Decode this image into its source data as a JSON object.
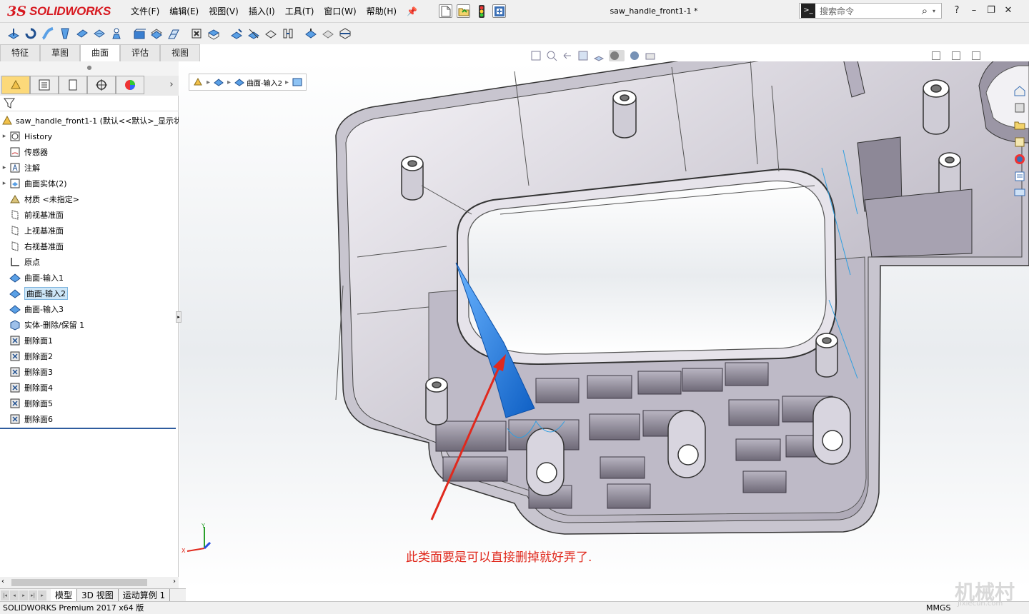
{
  "app": {
    "logo_ds": "3S",
    "logo_name": "SOLIDWORKS",
    "doc_title": "saw_handle_front1-1 *"
  },
  "menu": [
    "文件(F)",
    "编辑(E)",
    "视图(V)",
    "插入(I)",
    "工具(T)",
    "窗口(W)",
    "帮助(H)"
  ],
  "search": {
    "placeholder": "搜索命令"
  },
  "window_buttons": [
    "?",
    "–",
    "❐",
    "✕"
  ],
  "command_tabs": [
    "特征",
    "草图",
    "曲面",
    "评估",
    "视图"
  ],
  "active_command_tab": "曲面",
  "breadcrumb": {
    "item": "曲面-输入2"
  },
  "tree": {
    "root_label": "saw_handle_front1-1 (默认<<默认>_显示状",
    "items": [
      {
        "label": "History",
        "icon": "history-icon",
        "expandable": true
      },
      {
        "label": "传感器",
        "icon": "sensor-icon",
        "expandable": false
      },
      {
        "label": "注解",
        "icon": "annotation-icon",
        "expandable": true
      },
      {
        "label": "曲面实体(2)",
        "icon": "surface-bodies-icon",
        "expandable": true
      },
      {
        "label": "材质 <未指定>",
        "icon": "material-icon",
        "expandable": false
      },
      {
        "label": "前视基准面",
        "icon": "plane-icon",
        "expandable": false
      },
      {
        "label": "上视基准面",
        "icon": "plane-icon",
        "expandable": false
      },
      {
        "label": "右视基准面",
        "icon": "plane-icon",
        "expandable": false
      },
      {
        "label": "原点",
        "icon": "origin-icon",
        "expandable": false
      },
      {
        "label": "曲面-输入1",
        "icon": "surface-import-icon",
        "expandable": false
      },
      {
        "label": "曲面-输入2",
        "icon": "surface-import-icon",
        "expandable": false,
        "selected": true
      },
      {
        "label": "曲面-输入3",
        "icon": "surface-import-icon",
        "expandable": false
      },
      {
        "label": "实体-删除/保留 1",
        "icon": "body-delete-icon",
        "expandable": false
      },
      {
        "label": "删除面1",
        "icon": "delete-face-icon",
        "expandable": false
      },
      {
        "label": "删除面2",
        "icon": "delete-face-icon",
        "expandable": false
      },
      {
        "label": "删除面3",
        "icon": "delete-face-icon",
        "expandable": false
      },
      {
        "label": "删除面4",
        "icon": "delete-face-icon",
        "expandable": false
      },
      {
        "label": "删除面5",
        "icon": "delete-face-icon",
        "expandable": false
      },
      {
        "label": "删除面6",
        "icon": "delete-face-icon",
        "expandable": false
      }
    ]
  },
  "bottom_tabs": [
    "模型",
    "3D 视图",
    "运动算例 1"
  ],
  "status": {
    "product": "SOLIDWORKS Premium 2017 x64 版",
    "units": "MMGS"
  },
  "annotation": "此类面要是可以直接删掉就好弄了.",
  "watermark": {
    "big": "机械村",
    "small": "Jixiecun.com"
  },
  "triad": {
    "x": "X",
    "y": "Y"
  },
  "colors": {
    "accent_red": "#d71920",
    "annotation_red": "#e0291d",
    "selection_blue": "#1f7fe0"
  }
}
